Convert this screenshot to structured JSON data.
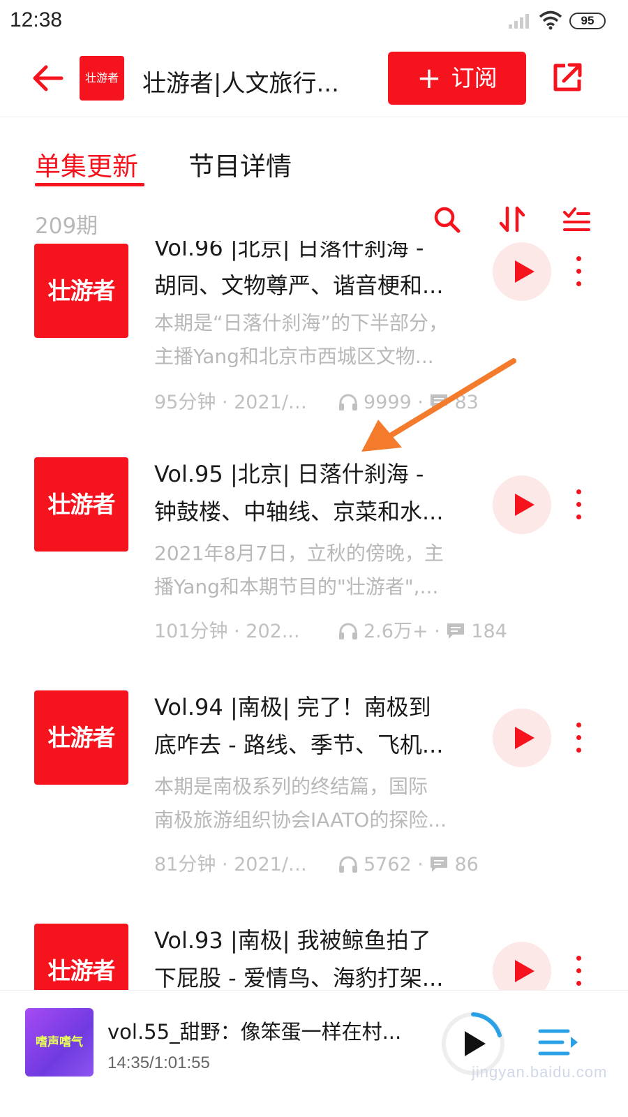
{
  "status_bar": {
    "time": "12:38",
    "battery": "95"
  },
  "header": {
    "logo_text": "壮游者",
    "title": "壮游者|人文旅行...",
    "subscribe_label": "订阅"
  },
  "tabs": [
    {
      "label": "单集更新",
      "active": true
    },
    {
      "label": "节目详情",
      "active": false
    }
  ],
  "episode_count": "209期",
  "cover_text": "壮游者",
  "episodes": [
    {
      "title_lines": [
        "Vol.96 |北京| 日落什刹海 -",
        "胡同、文物尊严、谐音梗和..."
      ],
      "desc_lines": [
        "本期是“日落什刹海”的下半部分，",
        "主播Yang和北京市西城区文物..."
      ],
      "duration_date": "95分钟 · 2021/0...",
      "plays": "9999",
      "comments": "83"
    },
    {
      "title_lines": [
        "Vol.95 |北京| 日落什刹海 -",
        "钟鼓楼、中轴线、京菜和水..."
      ],
      "desc_lines": [
        "2021年8月7日，立秋的傍晚，主",
        "播Yang和本期节目的\"壮游者\",..."
      ],
      "duration_date": "101分钟 · 202...",
      "plays": "2.6万+",
      "comments": "184"
    },
    {
      "title_lines": [
        "Vol.94 |南极| 完了！南极到",
        "底咋去 - 路线、季节、飞机..."
      ],
      "desc_lines": [
        "本期是南极系列的终结篇，国际",
        "南极旅游组织协会IAATO的探险..."
      ],
      "duration_date": "81分钟 · 2021/0...",
      "plays": "5762",
      "comments": "86"
    },
    {
      "title_lines": [
        "Vol.93 |南极| 我被鲸鱼拍了",
        "下屁股 - 爱情鸟、海豹打架..."
      ],
      "desc_lines": [
        "",
        ""
      ],
      "duration_date": "",
      "plays": "",
      "comments": ""
    }
  ],
  "player": {
    "cover_text": "嗜声嗜气",
    "title": "vol.55_甜野：像笨蛋一样在村...",
    "time": "14:35/1:01:55",
    "watermark": "jingyan.baidu.com"
  },
  "colors": {
    "accent": "#f5141e",
    "arrow": "#f47a2c"
  }
}
